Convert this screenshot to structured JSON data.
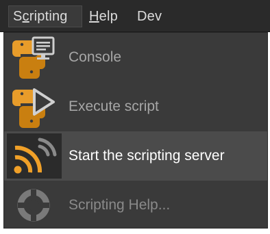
{
  "menubar": {
    "items": [
      {
        "label_prefix": "S",
        "label_underlined": "c",
        "label_suffix": "ripting",
        "active": true
      },
      {
        "label_prefix": "",
        "label_underlined": "H",
        "label_suffix": "elp",
        "active": false
      },
      {
        "label_prefix": "Dev",
        "label_underlined": "",
        "label_suffix": "",
        "active": false
      }
    ]
  },
  "dropdown": {
    "items": [
      {
        "label": "Console",
        "icon": "python-console-icon",
        "state": "normal"
      },
      {
        "label": "Execute script",
        "icon": "python-execute-icon",
        "state": "normal"
      },
      {
        "label": "Start the scripting server",
        "icon": "broadcast-signal-icon",
        "state": "highlighted"
      },
      {
        "label": "Scripting Help...",
        "icon": "help-lifebuoy-icon",
        "state": "disabled"
      }
    ]
  },
  "colors": {
    "python_orange": "#e89c2a",
    "python_dark": "#c97f10",
    "signal_orange": "#f0a028",
    "menu_bg": "#3a3a3a",
    "highlight_bg": "#4b4b4b"
  }
}
